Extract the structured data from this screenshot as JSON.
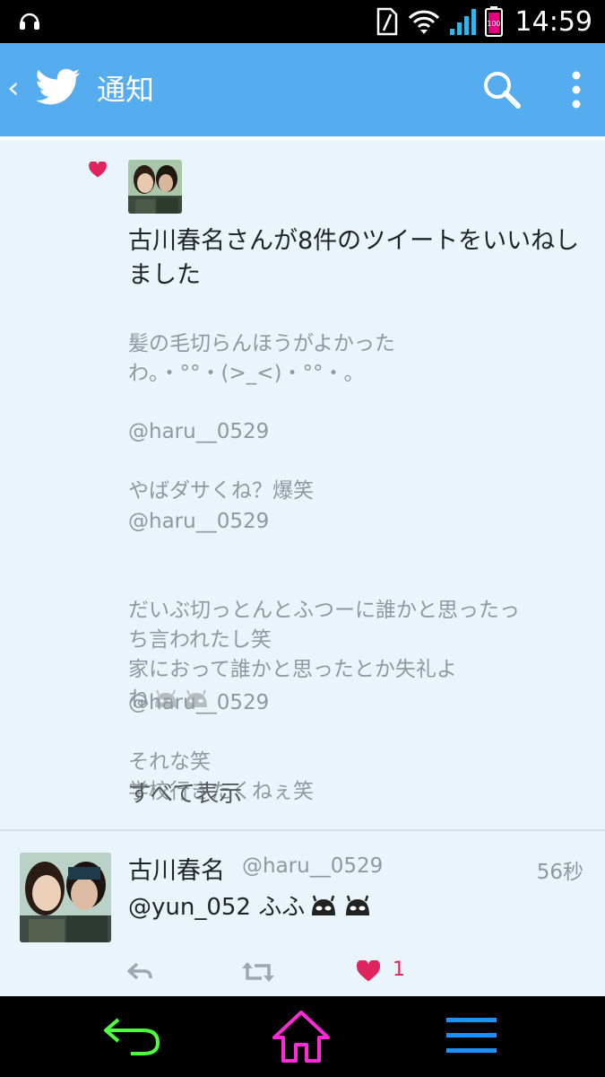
{
  "status_bar": {
    "time": "14:59",
    "battery": "100"
  },
  "app_bar": {
    "back_glyph": "‹",
    "title": "通知"
  },
  "notification": {
    "title": "古川春名さんが8件のツイートをいいねしました",
    "tweets": [
      {
        "handle": "",
        "text": "髪の毛切らんほうがよかった\nわ。・°°・(>_<)・°°・。"
      },
      {
        "handle": "@haru__0529",
        "text": "やばダサくね？爆笑"
      },
      {
        "handle": "@haru__0529",
        "text": "だいぶ切っとんとふつーに誰かと思ったっ\nち言われたし笑\n家におって誰かと思ったとか失礼よ\nね"
      },
      {
        "handle": "@haru__0529",
        "text": "それな笑\n学校行きたくねぇ笑"
      }
    ],
    "show_all": "すべて表示"
  },
  "tweet": {
    "name": "古川春名",
    "handle": "@haru__0529",
    "time": "56秒",
    "text": "@yun_052 ふふ",
    "like_count": "1"
  },
  "icons": {
    "status": [
      "headset-icon",
      "sim-icon",
      "wifi-icon",
      "signal-icon",
      "battery-icon"
    ],
    "app_bar": [
      "twitter-bird-icon",
      "search-icon",
      "more-vert-icon"
    ],
    "actions": [
      "reply-icon",
      "retweet-icon",
      "heart-icon"
    ],
    "nav": [
      "nav-back-icon",
      "nav-home-icon",
      "nav-menu-icon"
    ]
  },
  "colors": {
    "brand_blue": "#55acee",
    "like_red": "#e0245e",
    "nav_back_green": "#4cff3a",
    "nav_home_magenta": "#ff2bd6",
    "nav_menu_blue": "#1e90ff"
  }
}
